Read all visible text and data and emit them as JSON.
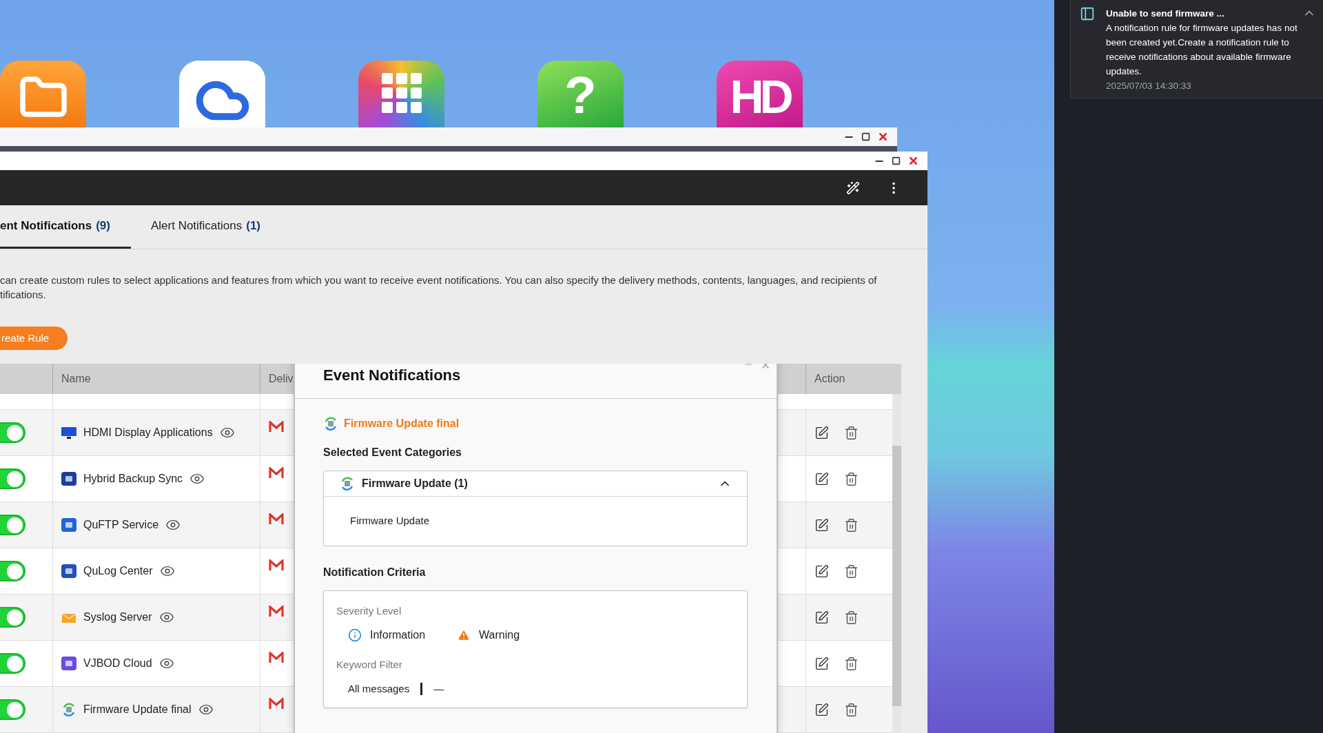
{
  "desktop_icons": [
    {
      "kind": "folder"
    },
    {
      "kind": "cloud"
    },
    {
      "kind": "grid"
    },
    {
      "kind": "help",
      "glyph": "?"
    },
    {
      "kind": "hd",
      "glyph": "HD"
    }
  ],
  "tabs": [
    {
      "label": "ent Notifications",
      "count": "(9)",
      "selected": true
    },
    {
      "label": "Alert Notifications",
      "count": "(1)",
      "selected": false
    }
  ],
  "description_lines": [
    "can create custom rules to select applications and features from which you want to receive event notifications. You can also specify the delivery methods, contents, languages, and recipients of",
    "tifications."
  ],
  "create_button": "reate Rule",
  "table": {
    "columns": [
      "Name",
      "Deliv",
      "Action"
    ],
    "rows": [
      {
        "on": true,
        "kind": "monitor",
        "name": "HDMI Display Applications"
      },
      {
        "on": true,
        "kind": "app",
        "name": "Hybrid Backup Sync"
      },
      {
        "on": true,
        "kind": "app",
        "name": "QuFTP Service"
      },
      {
        "on": true,
        "kind": "app",
        "name": "QuLog Center"
      },
      {
        "on": true,
        "kind": "envelope",
        "name": "Syslog Server"
      },
      {
        "on": true,
        "kind": "app",
        "name": "VJBOD Cloud"
      },
      {
        "on": true,
        "kind": "firmware",
        "name": "Firmware Update final"
      }
    ]
  },
  "dialog": {
    "title": "Event Notifications",
    "rule_name": "Firmware Update final",
    "categories_heading": "Selected Event Categories",
    "category": {
      "label": "Firmware Update (1)",
      "expanded": true,
      "items": [
        "Firmware Update"
      ]
    },
    "criteria_heading": "Notification Criteria",
    "severity_label": "Severity Level",
    "severities": [
      {
        "kind": "info",
        "label": "Information"
      },
      {
        "kind": "warning",
        "label": "Warning"
      }
    ],
    "keyword_label": "Keyword Filter",
    "keyword_mode": "All messages",
    "keyword_value": "—"
  },
  "notification": {
    "title": "Unable to send firmware ...",
    "body": "A notification rule for firmware updates has not been created yet.Create a notification rule to receive notifications about available firmware updates.",
    "time": "2025/07/03 14:30:33"
  }
}
